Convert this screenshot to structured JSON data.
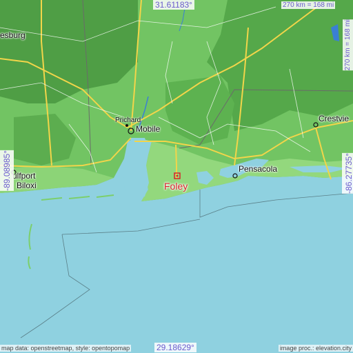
{
  "map": {
    "coords": {
      "north": "31.61183°",
      "south": "29.18629°",
      "west": "-89.08985°",
      "east": "-86.27735°"
    },
    "scale": {
      "top": "270 km = 168 mi",
      "side": "270 km = 168 mi"
    },
    "cities": {
      "focus": "Foley",
      "mobile": "Mobile",
      "prichard": "Prichard",
      "pensacola": "Pensacola",
      "crestview": "Crestvie",
      "gulfport": "ulfport",
      "biloxi": "Biloxi",
      "hattiesburg": "esburg"
    },
    "credits": {
      "left": "map data: openstreetmap, style: opentopomap",
      "right": "image proc.: elevation.city"
    },
    "colors": {
      "water": "#8fd1e0",
      "lowland": "#7ccf6b",
      "highland": "#5aa84e",
      "coast_land": "#9edb86",
      "roads": "#f2d54a",
      "focus_marker": "#d9232a",
      "coord_text": "#6a5acd"
    }
  }
}
